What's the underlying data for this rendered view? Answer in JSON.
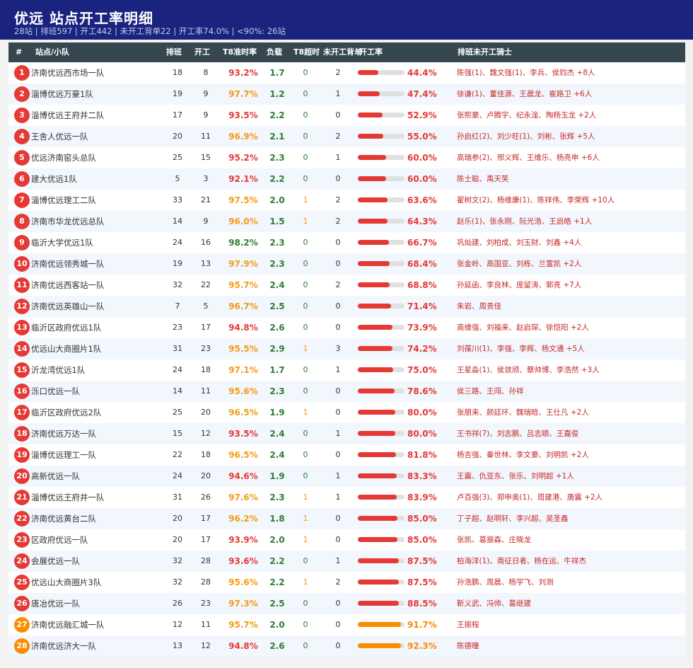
{
  "header": {
    "title": "优远  站点开工率明细",
    "subtitle": "28站 | 排班597 | 开工442 | 未开工背单22 | 开工率74.0% | <90%: 26站"
  },
  "columns": {
    "rank": "#",
    "name": "站点/小队",
    "pb": "排班",
    "kg": "开工",
    "t8": "T8准时率",
    "fz": "负载",
    "cs": "T8超时",
    "wk": "未开工背单",
    "rate": "开工率",
    "riders": "排班未开工骑士"
  },
  "colors": {
    "red": "#e53935",
    "orange": "#fb8c00",
    "gold": "#f39c12",
    "green": "#2e7d32",
    "navy": "#1a237e"
  },
  "rows": [
    {
      "rank": "1",
      "name": "济南优远西市场一队",
      "pb": "18",
      "kg": "8",
      "t8": "93.2%",
      "fz": "1.7",
      "cs": "0",
      "wk": "2",
      "rate": "44.4%",
      "pct": 44.4,
      "riders": "陈强(1)、魏文强(1)、李兵、侯钧杰 +8人"
    },
    {
      "rank": "2",
      "name": "淄博优远万豪1队",
      "pb": "19",
      "kg": "9",
      "t8": "97.7%",
      "fz": "1.2",
      "cs": "0",
      "wk": "1",
      "rate": "47.4%",
      "pct": 47.4,
      "riders": "徐谦(1)、董佳源、王晨龙、崔路卫 +6人"
    },
    {
      "rank": "3",
      "name": "淄博优远王府井二队",
      "pb": "17",
      "kg": "9",
      "t8": "93.5%",
      "fz": "2.2",
      "cs": "0",
      "wk": "0",
      "rate": "52.9%",
      "pct": 52.9,
      "riders": "张熙豪、卢腾宇、纪永淦、陶杨玉龙 +2人"
    },
    {
      "rank": "4",
      "name": "王舍人优远一队",
      "pb": "20",
      "kg": "11",
      "t8": "96.9%",
      "fz": "2.1",
      "cs": "0",
      "wk": "2",
      "rate": "55.0%",
      "pct": 55.0,
      "riders": "孙启红(2)、刘少旺(1)、刘彬、张辉 +5人"
    },
    {
      "rank": "5",
      "name": "优远济南窑头总队",
      "pb": "25",
      "kg": "15",
      "t8": "95.2%",
      "fz": "2.3",
      "cs": "0",
      "wk": "1",
      "rate": "60.0%",
      "pct": 60.0,
      "riders": "高瑞参(2)、邢义辉、王维乐、杨亮申 +6人"
    },
    {
      "rank": "6",
      "name": "建大优远1队",
      "pb": "5",
      "kg": "3",
      "t8": "92.1%",
      "fz": "2.2",
      "cs": "0",
      "wk": "0",
      "rate": "60.0%",
      "pct": 60.0,
      "riders": "陈士聪、禹天笑"
    },
    {
      "rank": "7",
      "name": "淄博优远理工二队",
      "pb": "33",
      "kg": "21",
      "t8": "97.5%",
      "fz": "2.0",
      "cs": "1",
      "wk": "2",
      "rate": "63.6%",
      "pct": 63.6,
      "riders": "翟树文(2)、杨维康(1)、陈祥伟、李荣辉 +10人"
    },
    {
      "rank": "8",
      "name": "济南市华龙优远总队",
      "pb": "14",
      "kg": "9",
      "t8": "96.0%",
      "fz": "1.5",
      "cs": "1",
      "wk": "2",
      "rate": "64.3%",
      "pct": 64.3,
      "riders": "赵乐(1)、张永刚、阮光浩、王启皓 +1人"
    },
    {
      "rank": "9",
      "name": "临沂大学优远1队",
      "pb": "24",
      "kg": "16",
      "t8": "98.2%",
      "fz": "2.3",
      "cs": "0",
      "wk": "0",
      "rate": "66.7%",
      "pct": 66.7,
      "riders": "巩灿建、刘柏成、刘玉财、刘鑫 +4人"
    },
    {
      "rank": "10",
      "name": "济南优远领秀城一队",
      "pb": "19",
      "kg": "13",
      "t8": "97.9%",
      "fz": "2.3",
      "cs": "0",
      "wk": "0",
      "rate": "68.4%",
      "pct": 68.4,
      "riders": "张金岭、高国亚、刘栋、兰富凯 +2人"
    },
    {
      "rank": "11",
      "name": "济南优远西客站一队",
      "pb": "32",
      "kg": "22",
      "t8": "95.7%",
      "fz": "2.4",
      "cs": "0",
      "wk": "2",
      "rate": "68.8%",
      "pct": 68.8,
      "riders": "孙延函、李良林、庞留涛、郭亮 +7人"
    },
    {
      "rank": "12",
      "name": "济南优远英雄山一队",
      "pb": "7",
      "kg": "5",
      "t8": "96.7%",
      "fz": "2.5",
      "cs": "0",
      "wk": "0",
      "rate": "71.4%",
      "pct": 71.4,
      "riders": "朱岩、周贵佳"
    },
    {
      "rank": "13",
      "name": "临沂区政府优远1队",
      "pb": "23",
      "kg": "17",
      "t8": "94.8%",
      "fz": "2.6",
      "cs": "0",
      "wk": "0",
      "rate": "73.9%",
      "pct": 73.9,
      "riders": "高维强、刘福来、赵启琛、徐恺阳 +2人"
    },
    {
      "rank": "14",
      "name": "优远山大商圈片1队",
      "pb": "31",
      "kg": "23",
      "t8": "95.5%",
      "fz": "2.9",
      "cs": "1",
      "wk": "3",
      "rate": "74.2%",
      "pct": 74.2,
      "riders": "刘葆川(1)、李强、李辉、杨文通 +5人"
    },
    {
      "rank": "15",
      "name": "沂龙湾优远1队",
      "pb": "24",
      "kg": "18",
      "t8": "97.1%",
      "fz": "1.7",
      "cs": "0",
      "wk": "1",
      "rate": "75.0%",
      "pct": 75.0,
      "riders": "王星淼(1)、侯敛颀、蔡帅博、李浩然 +3人"
    },
    {
      "rank": "16",
      "name": "泺口优远一队",
      "pb": "14",
      "kg": "11",
      "t8": "95.6%",
      "fz": "2.3",
      "cs": "0",
      "wk": "0",
      "rate": "78.6%",
      "pct": 78.6,
      "riders": "侯三路、王闯、孙祥"
    },
    {
      "rank": "17",
      "name": "临沂区政府优远2队",
      "pb": "25",
      "kg": "20",
      "t8": "96.5%",
      "fz": "1.9",
      "cs": "1",
      "wk": "0",
      "rate": "80.0%",
      "pct": 80.0,
      "riders": "张朋来、颜廷环、魏瑞晗、王仕凡 +2人"
    },
    {
      "rank": "18",
      "name": "济南优远万达一队",
      "pb": "15",
      "kg": "12",
      "t8": "93.5%",
      "fz": "2.4",
      "cs": "0",
      "wk": "1",
      "rate": "80.0%",
      "pct": 80.0,
      "riders": "王书祥(7)、刘志鹏、吕志顺、王嘉俊"
    },
    {
      "rank": "19",
      "name": "淄博优远理工一队",
      "pb": "22",
      "kg": "18",
      "t8": "96.5%",
      "fz": "2.4",
      "cs": "0",
      "wk": "0",
      "rate": "81.8%",
      "pct": 81.8,
      "riders": "杨吉强、秦世林、李文豪、刘明凯 +2人"
    },
    {
      "rank": "20",
      "name": "高新优远一队",
      "pb": "24",
      "kg": "20",
      "t8": "94.6%",
      "fz": "1.9",
      "cs": "0",
      "wk": "1",
      "rate": "83.3%",
      "pct": 83.3,
      "riders": "王震、仇亚东、张乐、刘明超 +1人"
    },
    {
      "rank": "21",
      "name": "淄博优远王府井一队",
      "pb": "31",
      "kg": "26",
      "t8": "97.6%",
      "fz": "2.3",
      "cs": "1",
      "wk": "1",
      "rate": "83.9%",
      "pct": 83.9,
      "riders": "卢百强(3)、郑申奥(1)、周建港、唐震 +2人"
    },
    {
      "rank": "22",
      "name": "济南优远黄台二队",
      "pb": "20",
      "kg": "17",
      "t8": "96.2%",
      "fz": "1.8",
      "cs": "1",
      "wk": "0",
      "rate": "85.0%",
      "pct": 85.0,
      "riders": "丁子超、赵明轩、李兴超、吴圣鑫"
    },
    {
      "rank": "23",
      "name": "区政府优远一队",
      "pb": "20",
      "kg": "17",
      "t8": "93.9%",
      "fz": "2.0",
      "cs": "1",
      "wk": "0",
      "rate": "85.0%",
      "pct": 85.0,
      "riders": "张凯、葛振森、庄晓龙"
    },
    {
      "rank": "24",
      "name": "会展优远一队",
      "pb": "32",
      "kg": "28",
      "t8": "93.6%",
      "fz": "2.2",
      "cs": "0",
      "wk": "1",
      "rate": "87.5%",
      "pct": 87.5,
      "riders": "柏海洋(1)、南征日者、杨在运、牛祥杰"
    },
    {
      "rank": "25",
      "name": "优远山大商圈片3队",
      "pb": "32",
      "kg": "28",
      "t8": "95.6%",
      "fz": "2.2",
      "cs": "1",
      "wk": "2",
      "rate": "87.5%",
      "pct": 87.5,
      "riders": "孙浩鹏、周晨、杨宇飞、刘测"
    },
    {
      "rank": "26",
      "name": "唐冶优远一队",
      "pb": "26",
      "kg": "23",
      "t8": "97.3%",
      "fz": "2.5",
      "cs": "0",
      "wk": "0",
      "rate": "88.5%",
      "pct": 88.5,
      "riders": "靳义武、冯帅、葛继建"
    },
    {
      "rank": "27",
      "name": "济南优远融汇城一队",
      "pb": "12",
      "kg": "11",
      "t8": "95.7%",
      "fz": "2.0",
      "cs": "0",
      "wk": "0",
      "rate": "91.7%",
      "pct": 91.7,
      "riders": "王振程"
    },
    {
      "rank": "28",
      "name": "济南优远济大一队",
      "pb": "13",
      "kg": "12",
      "t8": "94.8%",
      "fz": "2.6",
      "cs": "0",
      "wk": "0",
      "rate": "92.3%",
      "pct": 92.3,
      "riders": "陈德曈"
    }
  ]
}
